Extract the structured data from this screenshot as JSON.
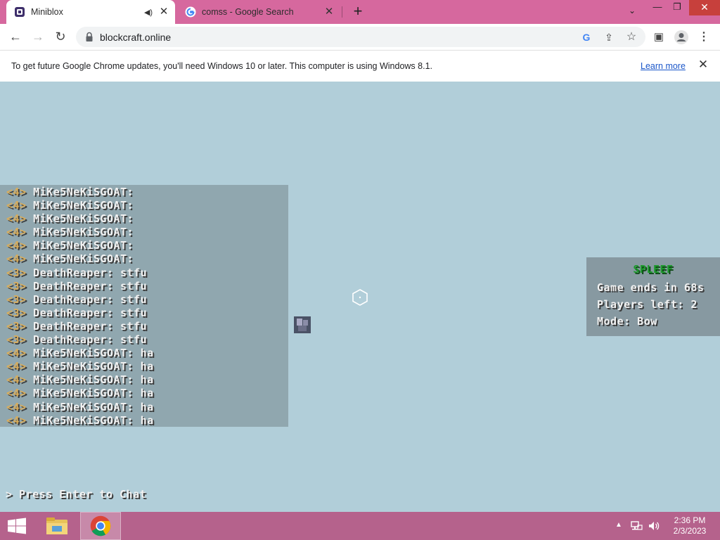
{
  "browser": {
    "tabs": [
      {
        "title": "Miniblox",
        "active": true,
        "audio": true
      },
      {
        "title": "comss - Google Search",
        "active": false,
        "audio": false
      }
    ],
    "new_tab_symbol": "+",
    "url": "blockcraft.online"
  },
  "infobar": {
    "message": "To get future Google Chrome updates, you'll need Windows 10 or later. This computer is using Windows 8.1.",
    "link": "Learn more"
  },
  "chat": {
    "lines": [
      {
        "rank": "<4>",
        "text": "MiKe5NeKiSGOAT:"
      },
      {
        "rank": "<4>",
        "text": "MiKe5NeKiSGOAT:"
      },
      {
        "rank": "<4>",
        "text": "MiKe5NeKiSGOAT:"
      },
      {
        "rank": "<4>",
        "text": "MiKe5NeKiSGOAT:"
      },
      {
        "rank": "<4>",
        "text": "MiKe5NeKiSGOAT:"
      },
      {
        "rank": "<4>",
        "text": "MiKe5NeKiSGOAT:"
      },
      {
        "rank": "<3>",
        "text": "DeathReaper: stfu"
      },
      {
        "rank": "<3>",
        "text": "DeathReaper: stfu"
      },
      {
        "rank": "<3>",
        "text": "DeathReaper: stfu"
      },
      {
        "rank": "<3>",
        "text": "DeathReaper: stfu"
      },
      {
        "rank": "<3>",
        "text": "DeathReaper: stfu"
      },
      {
        "rank": "<3>",
        "text": "DeathReaper: stfu"
      },
      {
        "rank": "<4>",
        "text": "MiKe5NeKiSGOAT: ha"
      },
      {
        "rank": "<4>",
        "text": "MiKe5NeKiSGOAT: ha"
      },
      {
        "rank": "<4>",
        "text": "MiKe5NeKiSGOAT: ha"
      },
      {
        "rank": "<4>",
        "text": "MiKe5NeKiSGOAT: ha"
      },
      {
        "rank": "<4>",
        "text": "MiKe5NeKiSGOAT: ha"
      },
      {
        "rank": "<4>",
        "text": "MiKe5NeKiSGOAT: ha"
      }
    ],
    "hint": "> Press Enter to Chat"
  },
  "scoreboard": {
    "title": "SPLEEF",
    "game_ends": "Game ends in 68s",
    "players_left": "Players left: 2",
    "mode": "Mode: Bow"
  },
  "taskbar": {
    "time": "2:36 PM",
    "date": "2/3/2023"
  },
  "colors": {
    "tabstrip": "#d6689e",
    "game_sky": "#b1ced9",
    "taskbar": "#b5628c",
    "rank_gold": "#d9ad5b",
    "spleef_green": "#1d9a2d"
  }
}
